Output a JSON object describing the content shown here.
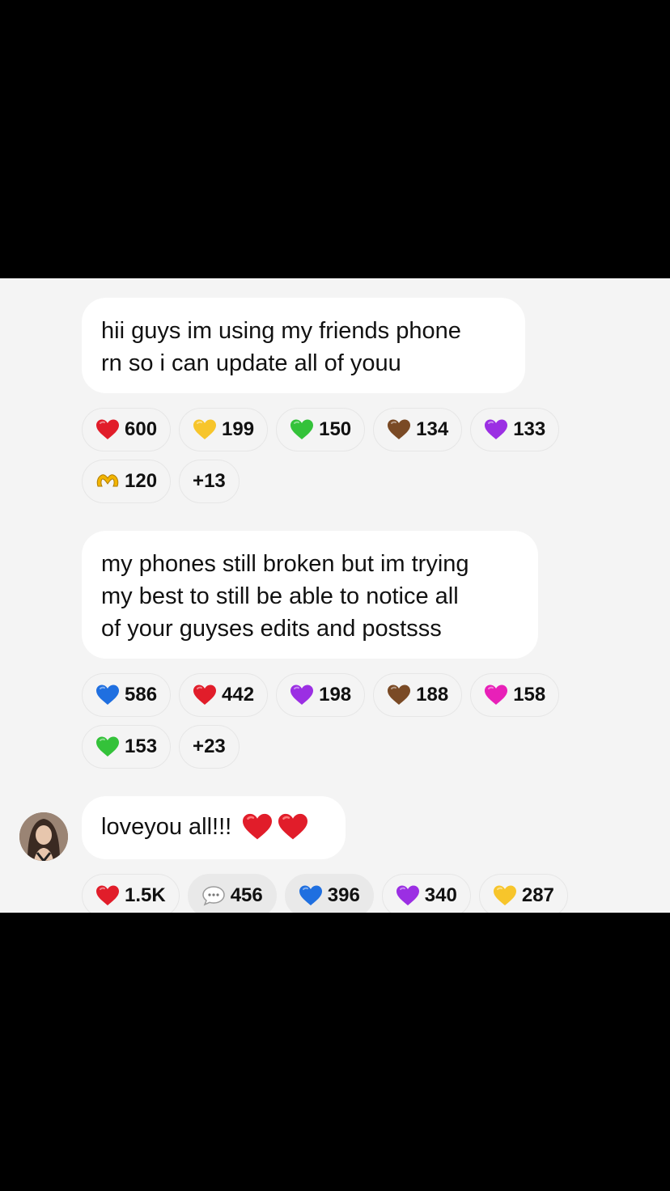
{
  "messages": [
    {
      "lines": [
        "hii guys im using my friends phone",
        "rn so i can update all of youu"
      ],
      "reactions": [
        {
          "icon": "red-heart-icon",
          "color": "#e11d2a",
          "count": "600"
        },
        {
          "icon": "yellow-heart-icon",
          "color": "#f7c52b",
          "count": "199"
        },
        {
          "icon": "green-heart-icon",
          "color": "#34c23a",
          "count": "150"
        },
        {
          "icon": "brown-heart-icon",
          "color": "#7a4a25",
          "count": "134"
        },
        {
          "icon": "purple-heart-icon",
          "color": "#9b2fe3",
          "count": "133"
        },
        {
          "icon": "heart-hands-icon",
          "color": "#f2b400",
          "count": "120"
        },
        {
          "icon": "more-icon",
          "color": "",
          "count": "+13"
        }
      ]
    },
    {
      "lines": [
        "my phones still broken but im trying",
        "my best to still be able to notice all",
        "of your guyses edits and postsss"
      ],
      "reactions": [
        {
          "icon": "blue-heart-icon",
          "color": "#1f6fe0",
          "count": "586"
        },
        {
          "icon": "red-heart-icon",
          "color": "#e11d2a",
          "count": "442"
        },
        {
          "icon": "purple-heart-icon",
          "color": "#9b2fe3",
          "count": "198"
        },
        {
          "icon": "brown-heart-icon",
          "color": "#7a4a25",
          "count": "188"
        },
        {
          "icon": "pink-heart-icon",
          "color": "#e820b8",
          "count": "158"
        },
        {
          "icon": "green-heart-icon",
          "color": "#34c23a",
          "count": "153"
        },
        {
          "icon": "more-icon",
          "color": "",
          "count": "+23"
        }
      ]
    },
    {
      "text": "loveyou all!!!",
      "emojis": [
        "red-heart-icon",
        "red-heart-icon"
      ],
      "reactions": [
        {
          "icon": "red-heart-icon",
          "color": "#e11d2a",
          "count": "1.5K"
        },
        {
          "icon": "speech-bubble-icon",
          "color": "#cfcfcf",
          "count": "456",
          "dark": true
        },
        {
          "icon": "blue-heart-icon",
          "color": "#1f6fe0",
          "count": "396",
          "dark": true
        },
        {
          "icon": "purple-heart-icon",
          "color": "#9b2fe3",
          "count": "340"
        },
        {
          "icon": "yellow-heart-icon",
          "color": "#f7c52b",
          "count": "287"
        }
      ]
    }
  ]
}
